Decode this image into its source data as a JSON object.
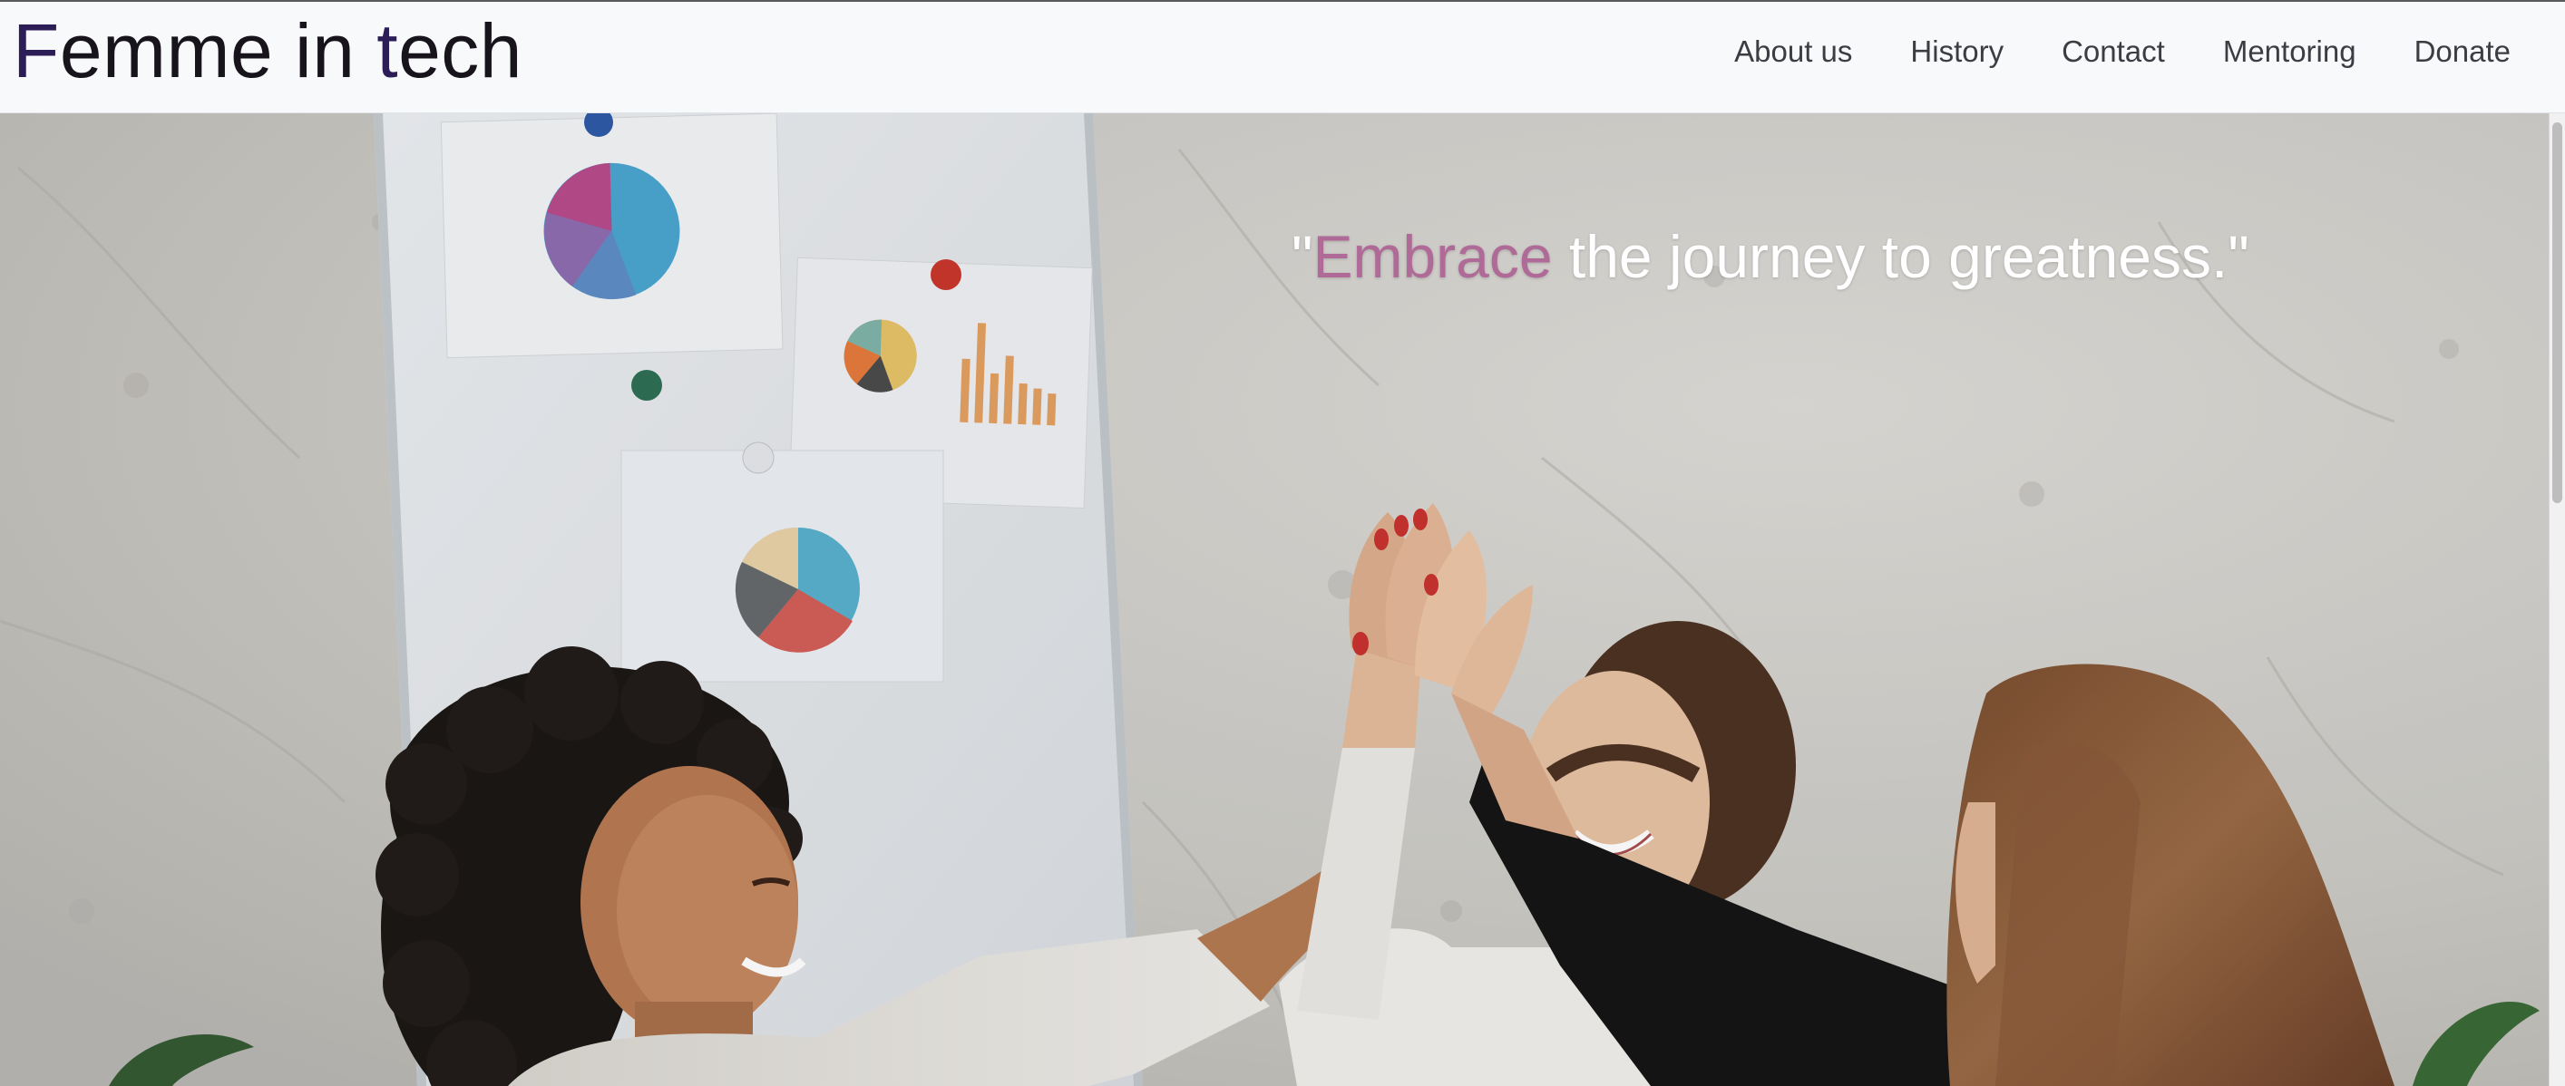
{
  "header": {
    "logo_start": "F",
    "logo_middle": "emme in ",
    "logo_t": "t",
    "logo_end": "ech",
    "nav": [
      {
        "label": "About us"
      },
      {
        "label": "History"
      },
      {
        "label": "Contact"
      },
      {
        "label": "Mentoring"
      },
      {
        "label": "Donate"
      }
    ]
  },
  "hero": {
    "quote_open": "\"",
    "quote_highlight": "Embrace",
    "quote_rest": " the journey to greatness.\"",
    "image": "team-high-five-photo"
  },
  "colors": {
    "logo_accent": "#2c1d57",
    "quote_highlight": "#b06a98",
    "nav_text": "#3c3c43",
    "header_bg": "#f8f9fb"
  }
}
